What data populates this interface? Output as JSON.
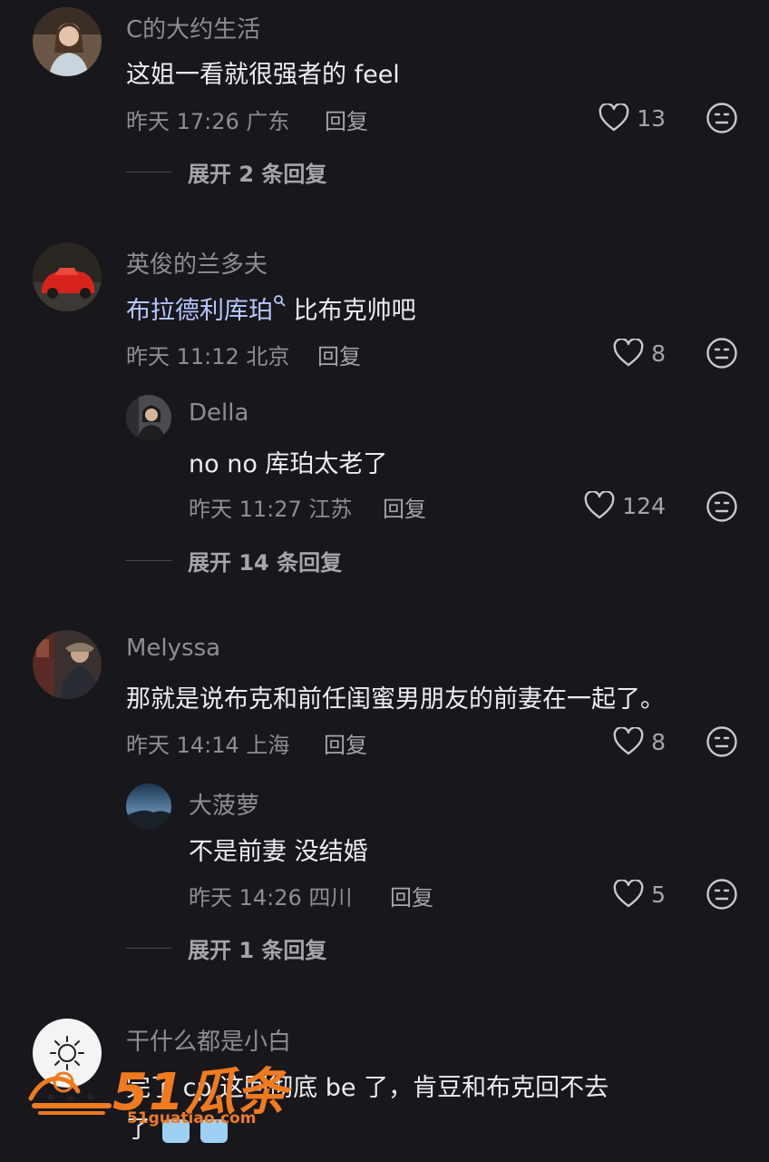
{
  "comments": [
    {
      "username": "C的大约生活",
      "text": "这姐一看就很强者的 feel",
      "time": "昨天 17:26 广东",
      "reply_label": "回复",
      "likes": "13",
      "expand_label": "展开 2 条回复"
    },
    {
      "username": "英俊的兰多夫",
      "text_link": "布拉德利库珀",
      "text_rest": " 比布克帅吧",
      "time": "昨天 11:12 北京",
      "reply_label": "回复",
      "likes": "8",
      "reply": {
        "username": "Della",
        "text": "no no 库珀太老了",
        "time": "昨天 11:27 江苏",
        "reply_label": "回复",
        "likes": "124"
      },
      "expand_label": "展开 14 条回复"
    },
    {
      "username": "Melyssa",
      "text": "那就是说布克和前任闺蜜男朋友的前妻在一起了。",
      "time": "昨天 14:14 上海",
      "reply_label": "回复",
      "likes": "8",
      "reply": {
        "username": "大菠萝",
        "text": "不是前妻 没结婚",
        "time": "昨天 14:26 四川",
        "reply_label": "回复",
        "likes": "5"
      },
      "expand_label": "展开 1 条回复"
    },
    {
      "username": "干什么都是小白",
      "text_line1_prefix": "完了",
      "text_line1_rest": "cp 这回彻底 be 了，肯豆和布克回不去",
      "text_line2": "了"
    }
  ],
  "watermark": {
    "logo_text": "51瓜条",
    "site_text": "51guatiao.com"
  },
  "colors": {
    "background": "#18171c",
    "text_primary": "#ededef",
    "text_secondary": "#8e8d93",
    "link": "#b7c8ff",
    "watermark_orange": "#f07a1e"
  }
}
